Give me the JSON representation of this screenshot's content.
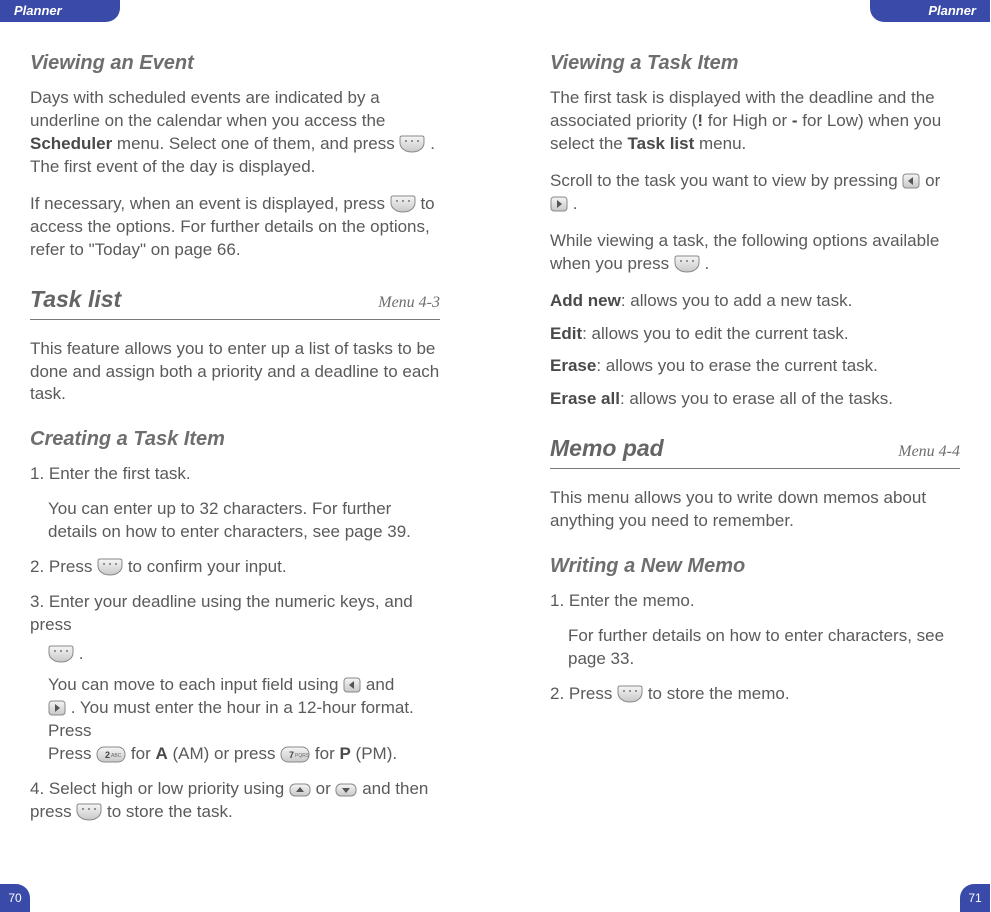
{
  "left": {
    "tab": "Planner",
    "pagenum": "70",
    "sec1": {
      "title": "Viewing an Event",
      "p1a": "Days with scheduled events are indicated by a underline on the calendar when you access the ",
      "p1b": "Scheduler",
      "p1c": " menu. Select one of them, and press ",
      "p1d": " . The first event of the day is displayed.",
      "p2a": "If necessary, when an event is displayed, press ",
      "p2b": " to access the options. For further details on the options, refer to \"Today\" on page 66."
    },
    "sec2": {
      "title": "Task list",
      "menu": "Menu 4-3",
      "p1": "This feature allows you to enter up a list of tasks to be done and assign both a priority and a deadline to each task."
    },
    "sec3": {
      "title": "Creating a Task Item",
      "s1": "1. Enter the first task.",
      "s1sub": "You can enter up to 32 characters. For further details on how to enter characters, see page 39.",
      "s2a": "2. Press ",
      "s2b": " to confirm your input.",
      "s3a": "3. Enter your deadline using the numeric keys, and press ",
      "s3b": " .",
      "s3suba": "You can move to each input field using ",
      "s3subb": " and ",
      "s3subc": " . You must enter the hour in a 12-hour format. Press ",
      "s3subd": " for ",
      "s3sube": "A",
      "s3subf": " (AM) or press ",
      "s3subg": " for ",
      "s3subh": "P",
      "s3subi": " (PM).",
      "s4a": "4. Select high or low priority using ",
      "s4b": " or ",
      "s4c": " and then press ",
      "s4d": " to store the task."
    }
  },
  "right": {
    "tab": "Planner",
    "pagenum": "71",
    "sec1": {
      "title": "Viewing a Task Item",
      "p1a": "The first task is displayed with the deadline and the associated priority (",
      "p1b": "!",
      "p1c": " for High or ",
      "p1d": "-",
      "p1e": " for Low) when you select the ",
      "p1f": "Task list",
      "p1g": " menu.",
      "p2a": "Scroll to the task you want to view by pressing ",
      "p2b": " or ",
      "p2c": " .",
      "p3a": "While viewing a task, the following options available when you press ",
      "p3b": " .",
      "d1a": "Add new",
      "d1b": ": allows you to add a new task.",
      "d2a": "Edit",
      "d2b": ": allows you to edit the current task.",
      "d3a": "Erase",
      "d3b": ": allows you to erase the current task.",
      "d4a": "Erase all",
      "d4b": ": allows you to erase all of the tasks."
    },
    "sec2": {
      "title": "Memo pad",
      "menu": "Menu 4-4",
      "p1": "This menu allows you to write down memos about anything you need to remember."
    },
    "sec3": {
      "title": "Writing a New Memo",
      "s1": "1. Enter the memo.",
      "s1sub": "For further details on how to enter characters, see page 33.",
      "s2a": "2. Press ",
      "s2b": " to store the memo."
    }
  }
}
